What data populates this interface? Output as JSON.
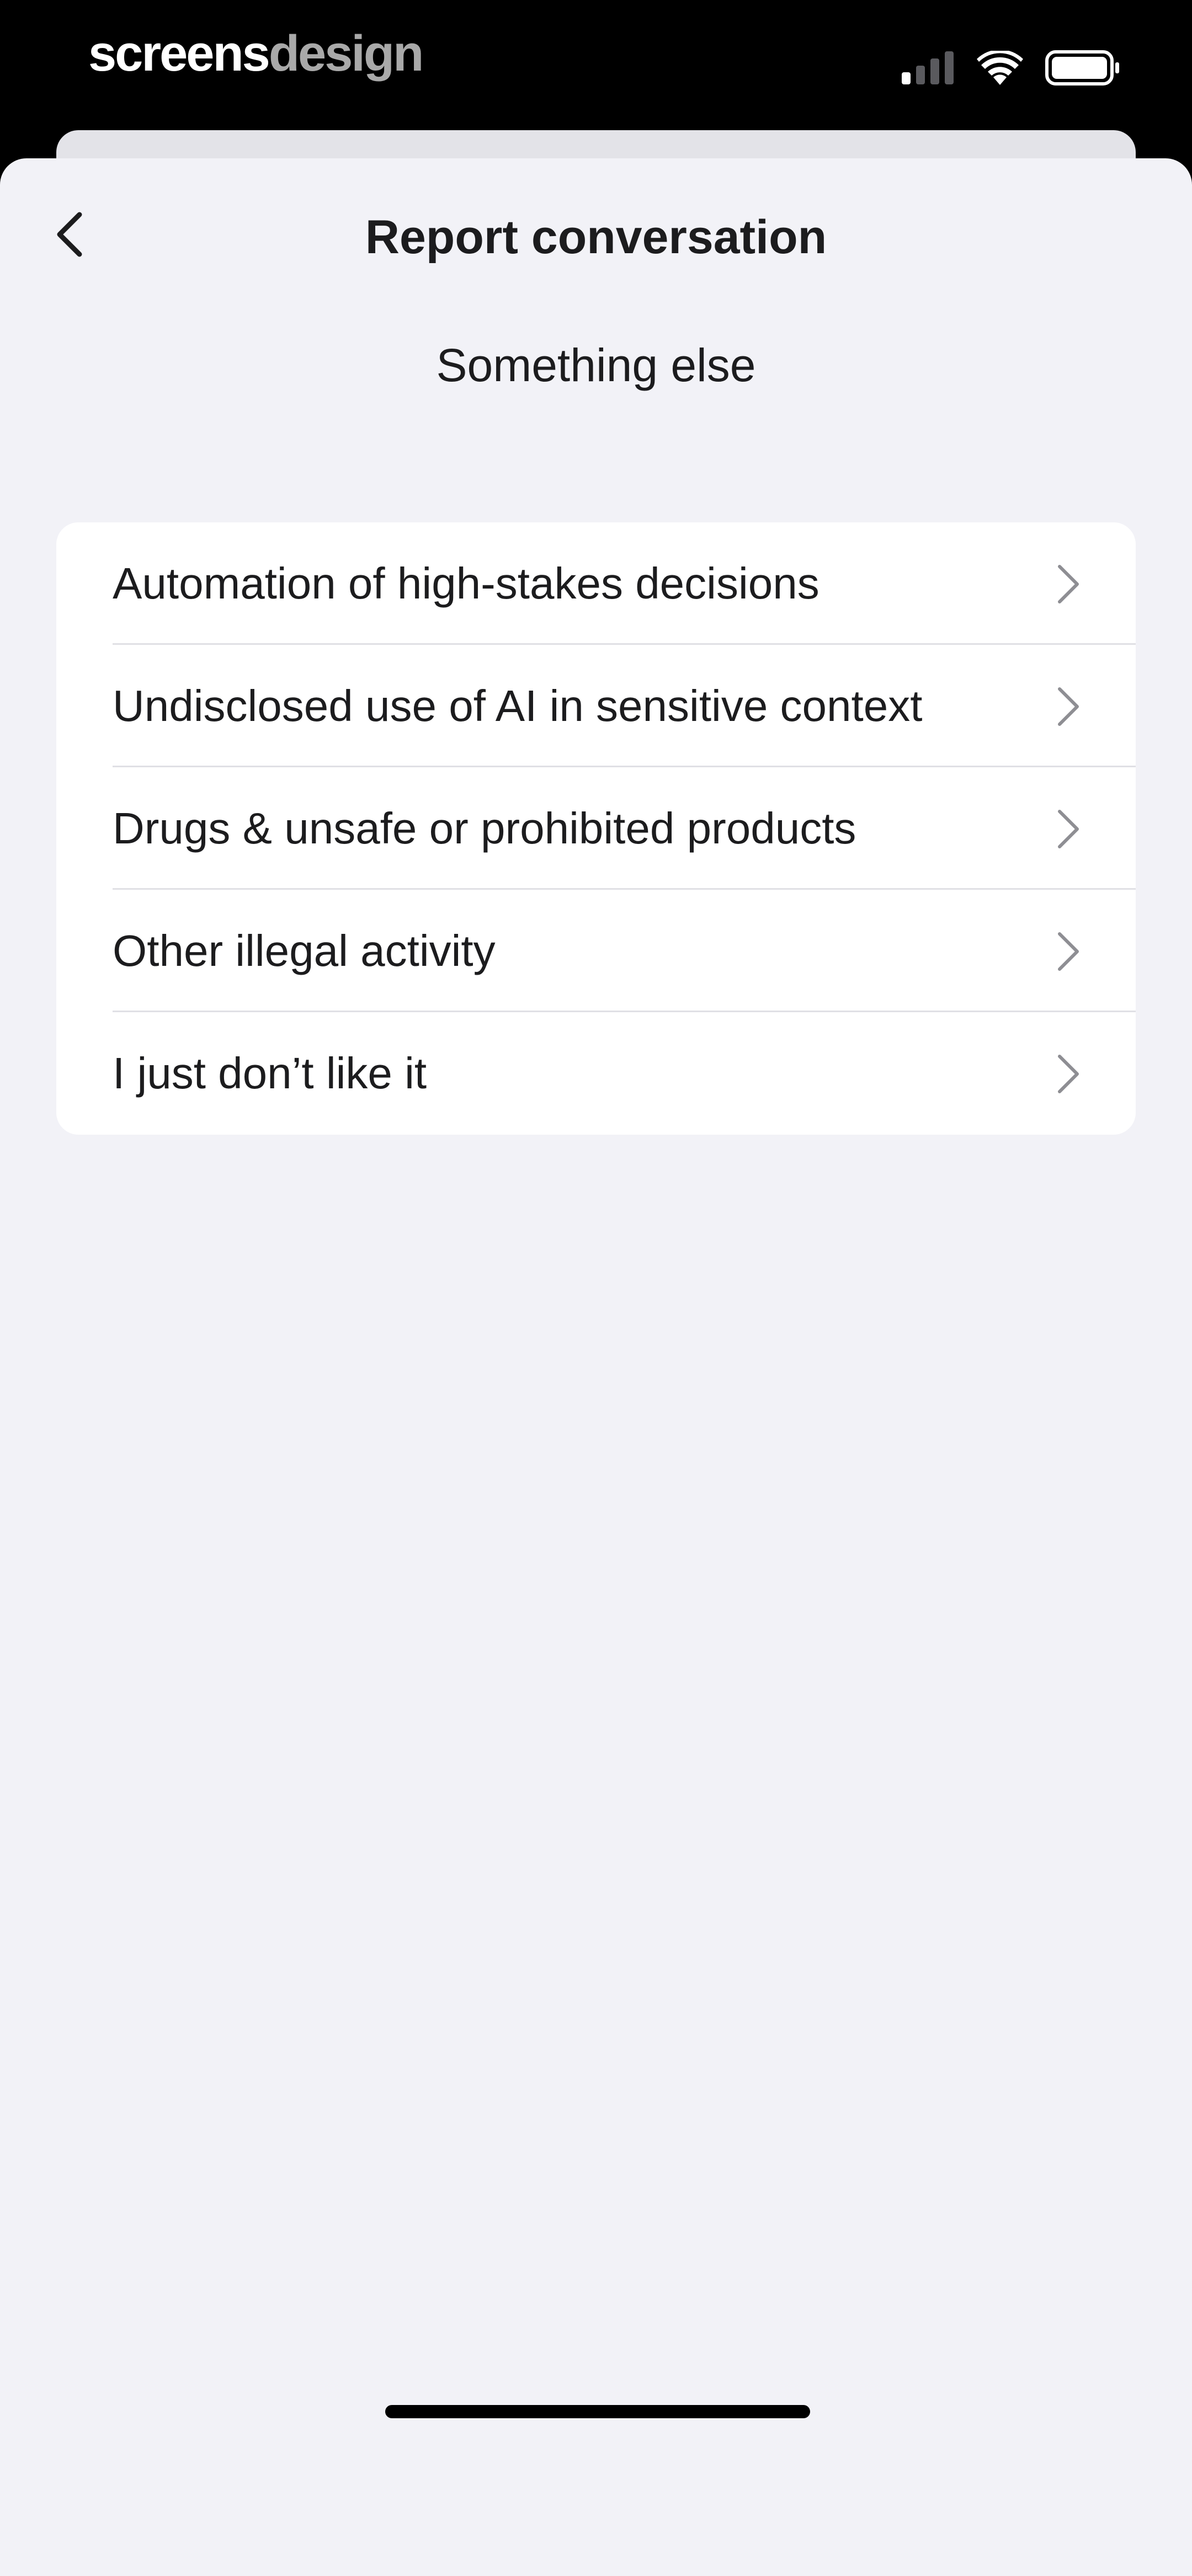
{
  "watermark": {
    "part1": "screens",
    "part2": "design"
  },
  "status_bar": {
    "icons": [
      "cellular-signal-icon",
      "wifi-icon",
      "battery-icon"
    ]
  },
  "nav": {
    "back_icon": "chevron-left-icon",
    "title": "Report conversation"
  },
  "subtitle": "Something else",
  "options": [
    {
      "label": "Automation of high-stakes decisions",
      "icon": "chevron-right-icon"
    },
    {
      "label": "Undisclosed use of AI in sensitive context",
      "icon": "chevron-right-icon"
    },
    {
      "label": "Drugs & unsafe or prohibited products",
      "icon": "chevron-right-icon"
    },
    {
      "label": "Other illegal activity",
      "icon": "chevron-right-icon"
    },
    {
      "label": "I just don’t like it",
      "icon": "chevron-right-icon"
    }
  ],
  "colors": {
    "background": "#f2f2f7",
    "card": "#ffffff",
    "text": "#1c1c1e",
    "chevron": "#8e8e93",
    "divider": "#e0e0e5"
  }
}
